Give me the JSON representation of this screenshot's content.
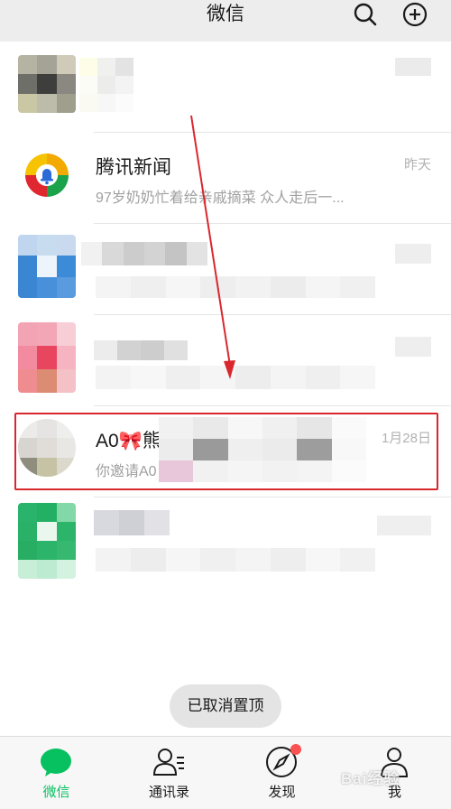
{
  "header": {
    "title": "微信",
    "search_icon": "search-icon",
    "add_icon": "plus-circle-icon"
  },
  "chats": [
    {
      "name": "",
      "preview": "",
      "time": ""
    },
    {
      "name": "腾讯新闻",
      "preview": "97岁奶奶忙着给亲戚摘菜 众人走后一...",
      "time": "昨天"
    },
    {
      "name": "",
      "preview": "",
      "time": ""
    },
    {
      "name": "",
      "preview": "",
      "time": ""
    },
    {
      "name": "A0🎀熊",
      "preview": "你邀请A0",
      "time": "1月28日"
    },
    {
      "name": "",
      "preview": "",
      "time": ""
    }
  ],
  "toast": {
    "text": "已取消置顶"
  },
  "tabbar": {
    "tabs": [
      {
        "label": "微信",
        "icon": "chat-bubble-icon"
      },
      {
        "label": "通讯录",
        "icon": "contacts-icon"
      },
      {
        "label": "发现",
        "icon": "compass-icon"
      },
      {
        "label": "我",
        "icon": "person-icon"
      }
    ]
  },
  "watermark": {
    "text": "Bai经验"
  },
  "colors": {
    "accent_green": "#07c160",
    "highlight_red": "#d9272e",
    "badge_red": "#fa5151",
    "header_bg": "#ededed"
  }
}
